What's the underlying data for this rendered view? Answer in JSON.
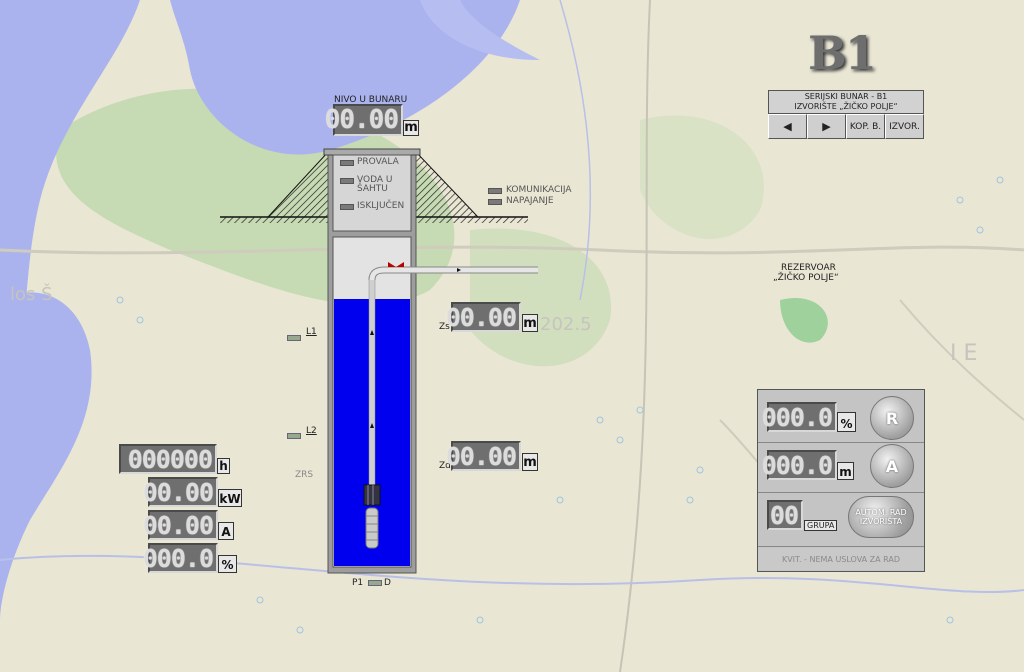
{
  "title_badge": "B1",
  "station": {
    "line1": "SERIJSKI BUNAR - B1",
    "line2": "IZVORIŠTE „ŽIČKO POLJE“",
    "nav_prev": "◀",
    "nav_next": "▶",
    "btn_kop": "KOP. B.",
    "btn_izvor": "IZVOR."
  },
  "level": {
    "label": "NIVO U BUNARU",
    "value": "00.00",
    "unit": "m"
  },
  "status_items": {
    "provala": "PROVALA",
    "voda_line1": "VODA U",
    "voda_line2": "ŠAHTU",
    "iskljucen": "ISKLJUČEN",
    "komunikacija": "KOMUNIKACIJA",
    "napajanje": "NAPAJANJE"
  },
  "reservoir": {
    "line1": "REZERVOAR",
    "line2": "„ŽIČKO POLJE“"
  },
  "zs": {
    "label": "Zs",
    "value": "00.00",
    "unit": "m"
  },
  "zd": {
    "label": "Zd",
    "value": "00.00",
    "unit": "m"
  },
  "levels": {
    "l1": "L1",
    "l2": "L2",
    "zrs": "ZRS"
  },
  "pump": {
    "p1": "P1",
    "d": "D"
  },
  "meters": {
    "hours": {
      "value": "000000",
      "unit": "h"
    },
    "power": {
      "value": "00.00",
      "unit": "kW"
    },
    "current": {
      "value": "00.00",
      "unit": "A"
    },
    "percent": {
      "value": "000.0",
      "unit": "%"
    }
  },
  "control": {
    "pct_value": "000.0",
    "pct_unit": "%",
    "btn_r": "R",
    "m_value": "000.0",
    "m_unit": "m",
    "btn_a": "A",
    "group_value": "00",
    "group_label": "GRUPA",
    "auto_line1": "AUTOM. RAD",
    "auto_line2": "IZVORIŠTA",
    "status": "KVIT. - NEMA USLOVA ZA RAD"
  },
  "colors": {
    "water": "#0000ee",
    "map_water": "#a9b4ee",
    "map_green": "#b4d5a6",
    "lcd_bg": "#6f6f6f"
  }
}
